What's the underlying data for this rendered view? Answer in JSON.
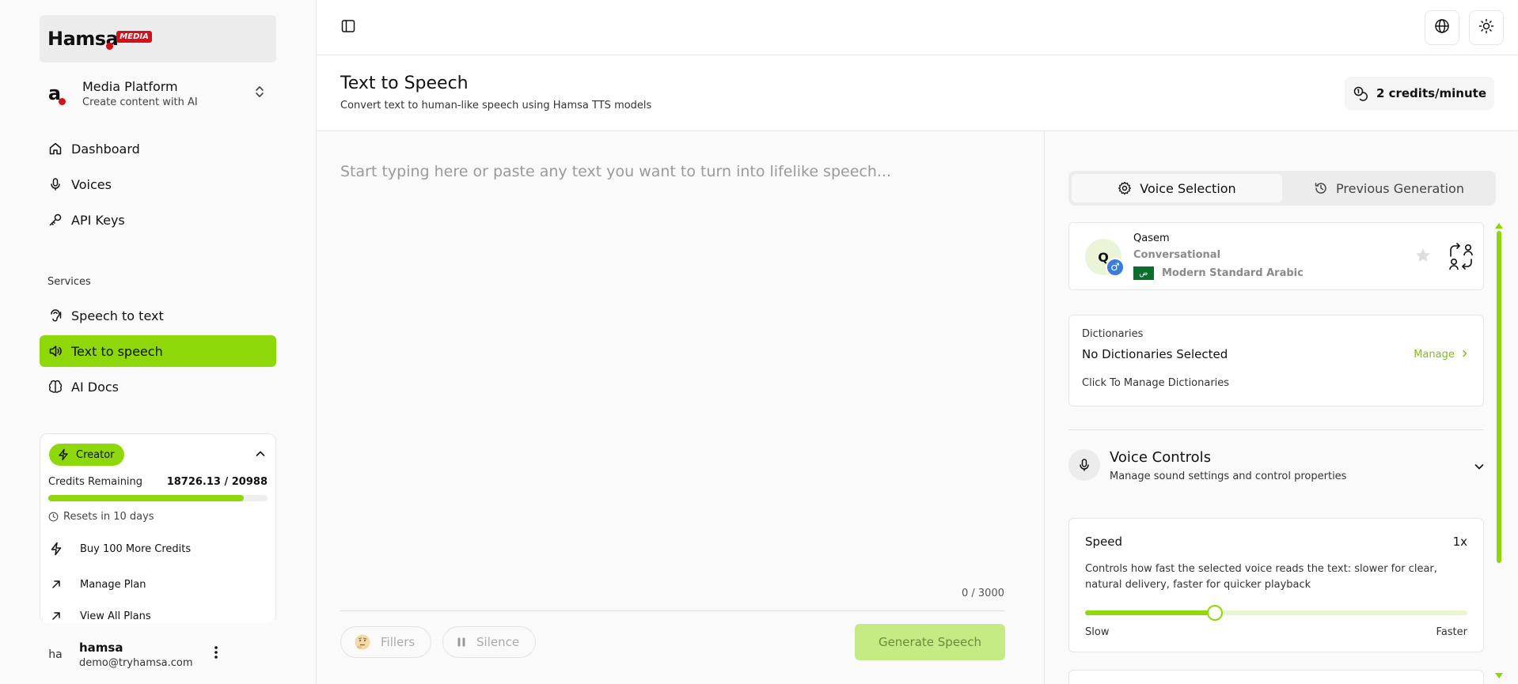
{
  "brand": {
    "logo_text": "Hamsa",
    "logo_badge": "MEDIA",
    "accent_color": "#8ed80a",
    "brand_red": "#d4111a"
  },
  "org": {
    "name": "Media Platform",
    "subtitle": "Create content with AI",
    "icon_letter": "a"
  },
  "nav": {
    "dashboard": "Dashboard",
    "voices": "Voices",
    "api_keys": "API Keys",
    "services_label": "Services",
    "speech_to_text": "Speech to text",
    "text_to_speech": "Text to speech",
    "ai_docs": "AI Docs"
  },
  "plan": {
    "name": "Creator",
    "credits_label": "Credits Remaining",
    "credits_value": "18726.13 / 20988",
    "credits_used_fraction": 0.892,
    "resets": "Resets in 10 days",
    "buy_credits": "Buy 100 More Credits",
    "manage_plan": "Manage Plan",
    "view_plans": "View All Plans"
  },
  "user": {
    "initials": "ha",
    "name": "hamsa",
    "email": "demo@tryhamsa.com"
  },
  "page": {
    "title": "Text to Speech",
    "subtitle": "Convert text to human-like speech using Hamsa TTS models",
    "credit_rate": "2 credits/minute"
  },
  "editor": {
    "placeholder": "Start typing here or paste any text you want to turn into lifelike speech...",
    "value": "",
    "counter": "0 / 3000",
    "fillers_label": "Fillers",
    "silence_label": "Silence",
    "generate_label": "Generate Speech"
  },
  "tabs": {
    "voice_selection": "Voice Selection",
    "previous_generation": "Previous Generation"
  },
  "voice": {
    "initial": "Q",
    "name": "Qasem",
    "style": "Conversational",
    "language": "Modern Standard Arabic",
    "flag_text": "ض",
    "gender_symbol": "♂"
  },
  "dictionaries": {
    "label": "Dictionaries",
    "title": "No Dictionaries Selected",
    "manage": "Manage",
    "hint": "Click To Manage Dictionaries"
  },
  "voice_controls": {
    "title": "Voice Controls",
    "subtitle": "Manage sound settings and control properties"
  },
  "speed": {
    "title": "Speed",
    "value": "1x",
    "slider_fraction": 0.34,
    "description": "Controls how fast the selected voice reads the text: slower for clear, natural delivery, faster for quicker playback",
    "slow_label": "Slow",
    "fast_label": "Faster"
  }
}
